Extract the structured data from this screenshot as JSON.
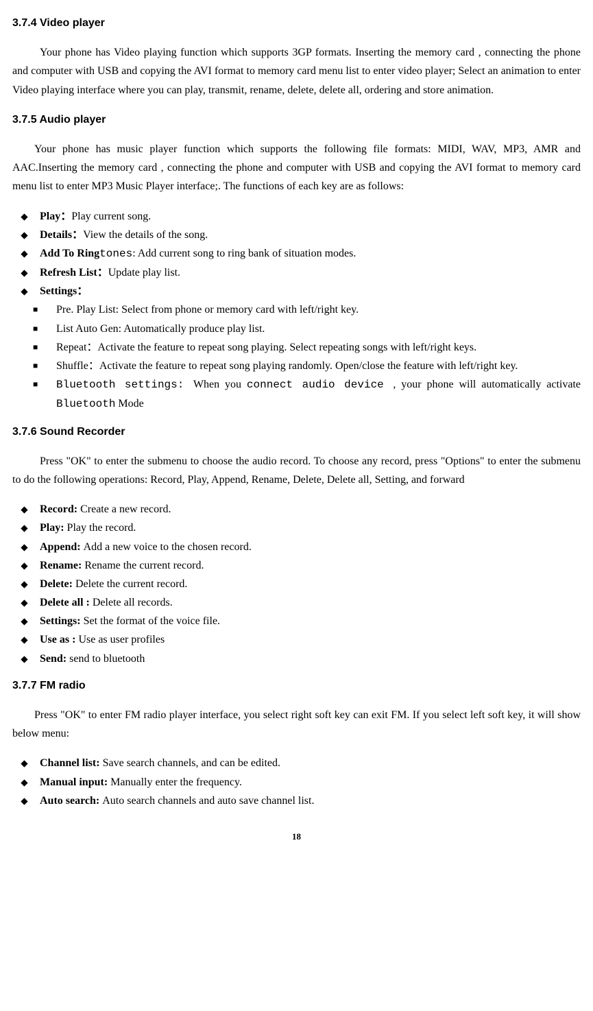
{
  "sections": {
    "video": {
      "heading": "3.7.4 Video player",
      "body": "Your phone has Video playing function which supports 3GP formats. Inserting the memory card , connecting the phone and computer with USB and copying the AVI format to memory card menu list to enter video player; Select an animation to enter Video playing interface where you can play, transmit, rename, delete, delete all, ordering and store animation."
    },
    "audio": {
      "heading": "3.7.5 Audio player",
      "body": "Your phone has music player function which supports the following file formats: MIDI, WAV, MP3, AMR and AAC.Inserting the memory card , connecting the phone and computer with USB and copying the AVI format to memory card menu list to enter MP3 Music Player interface;. The functions of each key are as follows:",
      "items": {
        "play_label": "Play：",
        "play_text": "Play current song.",
        "details_label": "Details：",
        "details_text": "View the details of the song.",
        "ring_label": "Add To Ring",
        "ring_mono": "tones",
        "ring_text": ": Add current song to ring bank of situation modes.",
        "refresh_label": "Refresh List：",
        "refresh_text": "Update play list.",
        "settings_label": "Settings："
      },
      "settings_sub": {
        "pre": "Pre. Play List: Select from phone or memory card with left/right key.",
        "listauto": "List Auto Gen: Automatically produce play list.",
        "repeat": "Repeat：Activate the feature to repeat song playing. Select repeating songs with left/right keys.",
        "shuffle": "Shuffle：Activate the feature to repeat song playing randomly. Open/close the feature with left/right key.",
        "bt_label": "Bluetooth settings: ",
        "bt_mid1": "When you ",
        "bt_mono": "connect audio device ",
        "bt_mid2": ", your phone will automatically activate ",
        "bt_mono2": "Bluetooth",
        "bt_end": " Mode"
      }
    },
    "recorder": {
      "heading": "3.7.6 Sound Recorder",
      "body": "Press \"OK\" to enter the submenu to choose the audio record. To choose any record, press \"Options\" to enter the submenu to do the following operations: Record, Play, Append, Rename, Delete, Delete all, Setting, and forward",
      "items": {
        "record_label": "Record: ",
        "record_text": "Create a new record.",
        "play_label": "Play: ",
        "play_text": "Play the record.",
        "append_label": "Append: ",
        "append_text": "Add a new voice to the chosen record.",
        "rename_label": "Rename: ",
        "rename_text": "Rename the current record.",
        "delete_label": "Delete: ",
        "delete_text": "Delete the current record.",
        "deleteall_label": "Delete all : ",
        "deleteall_text": "Delete all records.",
        "settings_label": "Settings: ",
        "settings_text": "Set the format of the voice file.",
        "useas_label": "Use as : ",
        "useas_text": "Use as user profiles",
        "send_label": "Send: ",
        "send_text": "send to bluetooth"
      }
    },
    "fm": {
      "heading": "3.7.7 FM radio",
      "body": "Press \"OK\" to enter FM radio player interface, you select right soft key can exit FM. If you select left soft key, it will show below menu:",
      "body_prefix": "Press",
      "body_quote_ok": "\"OK\"",
      "body_suffix": "to enter FM radio player interface, you select right soft key can exit FM. If you select left soft key, it will show below menu:",
      "items": {
        "channel_label": "Channel list: ",
        "channel_text": "Save search channels, and can be edited.",
        "manual_label": "Manual input: ",
        "manual_text": "Manually enter the frequency.",
        "auto_label": "Auto search: ",
        "auto_text": "Auto search channels and auto save channel list."
      }
    }
  },
  "page_number": "18"
}
